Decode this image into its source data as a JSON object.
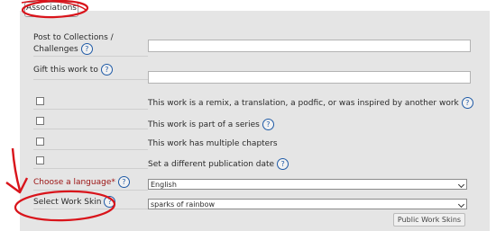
{
  "fieldset": {
    "legend": "Associations"
  },
  "fields": {
    "collections_label_line1": "Post to Collections /",
    "collections_label_line2": "Challenges",
    "gift_label": "Gift this work to",
    "help_symbol": "?",
    "remix_label": "This work is a remix, a translation, a podfic, or was inspired by another work",
    "series_label": "This work is part of a series",
    "chapters_label": "This work has multiple chapters",
    "pubdate_label": "Set a different publication date",
    "language_label": "Choose a language*",
    "language_value": "English",
    "skin_label": "Select Work Skin",
    "skin_value": "sparks of rainbow",
    "public_skins_button": "Public Work Skins"
  },
  "colors": {
    "panel": "#e5e5e5",
    "required_label": "#9b1111",
    "help_icon": "#1f5aa6",
    "annotation": "#d9141b"
  },
  "icons": {
    "help": "question-circle-icon",
    "select": "chevron-down-icon"
  }
}
